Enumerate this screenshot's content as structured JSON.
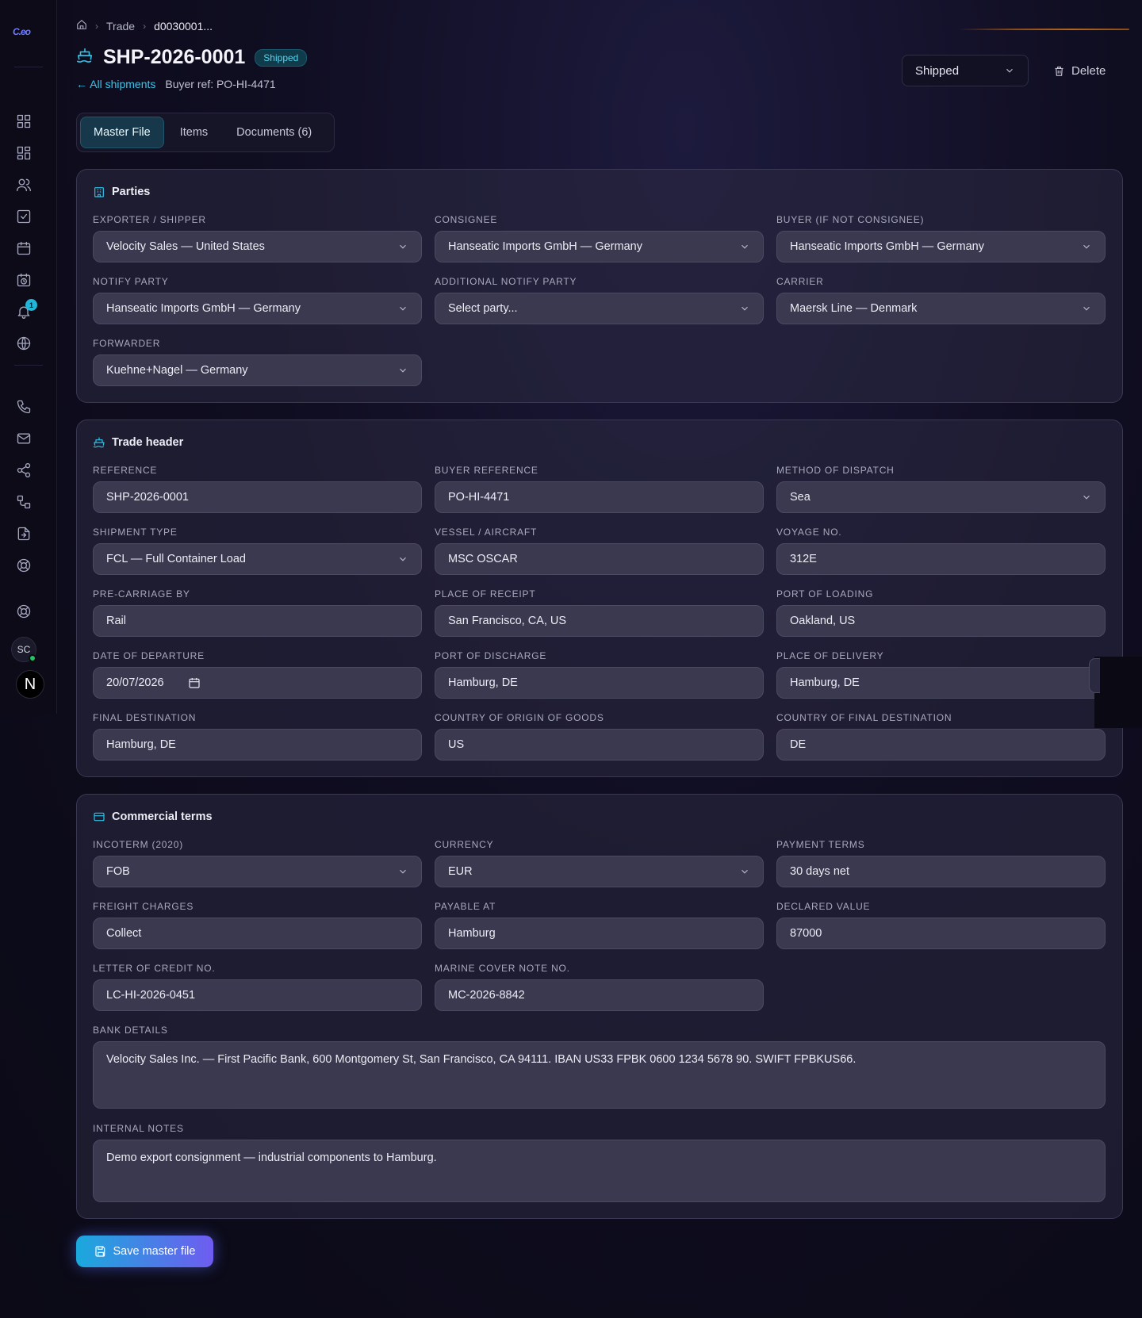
{
  "breadcrumb": {
    "level1": "Trade",
    "level2": "d0030001..."
  },
  "header": {
    "title": "SHP-2026-0001",
    "status_badge": "Shipped",
    "back_link": "All shipments",
    "buyer_ref": "Buyer ref: PO-HI-4471",
    "status_select": "Shipped",
    "delete_label": "Delete"
  },
  "tabs": [
    "Master File",
    "Items",
    "Documents (6)"
  ],
  "sidebar": {
    "notification_count": "1",
    "avatar_initials": "SC",
    "avatar_n": "N"
  },
  "parties": {
    "title": "Parties",
    "exporter_label": "Exporter / Shipper",
    "exporter": "Velocity Sales — United States",
    "consignee_label": "Consignee",
    "consignee": "Hanseatic Imports GmbH — Germany",
    "buyer_label": "Buyer (if not consignee)",
    "buyer": "Hanseatic Imports GmbH — Germany",
    "notify_label": "Notify party",
    "notify": "Hanseatic Imports GmbH — Germany",
    "add_notify_label": "Additional notify party",
    "add_notify_placeholder": "Select party...",
    "carrier_label": "Carrier",
    "carrier": "Maersk Line — Denmark",
    "forwarder_label": "Forwarder",
    "forwarder": "Kuehne+Nagel — Germany"
  },
  "trade": {
    "title": "Trade header",
    "reference_label": "Reference",
    "reference": "SHP-2026-0001",
    "buyer_ref_label": "Buyer reference",
    "buyer_ref": "PO-HI-4471",
    "dispatch_label": "Method of dispatch",
    "dispatch": "Sea",
    "shipment_type_label": "Shipment type",
    "shipment_type": "FCL — Full Container Load",
    "vessel_label": "Vessel / Aircraft",
    "vessel": "MSC OSCAR",
    "voyage_label": "Voyage no.",
    "voyage": "312E",
    "precarriage_label": "Pre-carriage by",
    "precarriage": "Rail",
    "receipt_label": "Place of receipt",
    "receipt": "San Francisco, CA, US",
    "loading_label": "Port of loading",
    "loading": "Oakland, US",
    "departure_label": "Date of departure",
    "departure": "20/07/2026",
    "discharge_label": "Port of discharge",
    "discharge": "Hamburg, DE",
    "delivery_label": "Place of delivery",
    "delivery": "Hamburg, DE",
    "final_dest_label": "Final destination",
    "final_dest": "Hamburg, DE",
    "origin_label": "Country of origin of goods",
    "origin": "US",
    "final_country_label": "Country of final destination",
    "final_country": "DE"
  },
  "commercial": {
    "title": "Commercial terms",
    "incoterm_label": "Incoterm (2020)",
    "incoterm": "FOB",
    "currency_label": "Currency",
    "currency": "EUR",
    "payment_label": "Payment terms",
    "payment": "30 days net",
    "freight_label": "Freight charges",
    "freight": "Collect",
    "payable_label": "Payable at",
    "payable": "Hamburg",
    "declared_label": "Declared value",
    "declared": "87000",
    "lc_label": "Letter of credit no.",
    "lc": "LC-HI-2026-0451",
    "marine_label": "Marine cover note no.",
    "marine": "MC-2026-8842",
    "bank_label": "Bank details",
    "bank": "Velocity Sales Inc. — First Pacific Bank, 600 Montgomery St, San Francisco, CA 94111. IBAN US33 FPBK 0600 1234 5678 90. SWIFT FPBKUS66.",
    "notes_label": "Internal notes",
    "notes": "Demo export consignment — industrial components to Hamburg."
  },
  "save_label": "Save master file"
}
